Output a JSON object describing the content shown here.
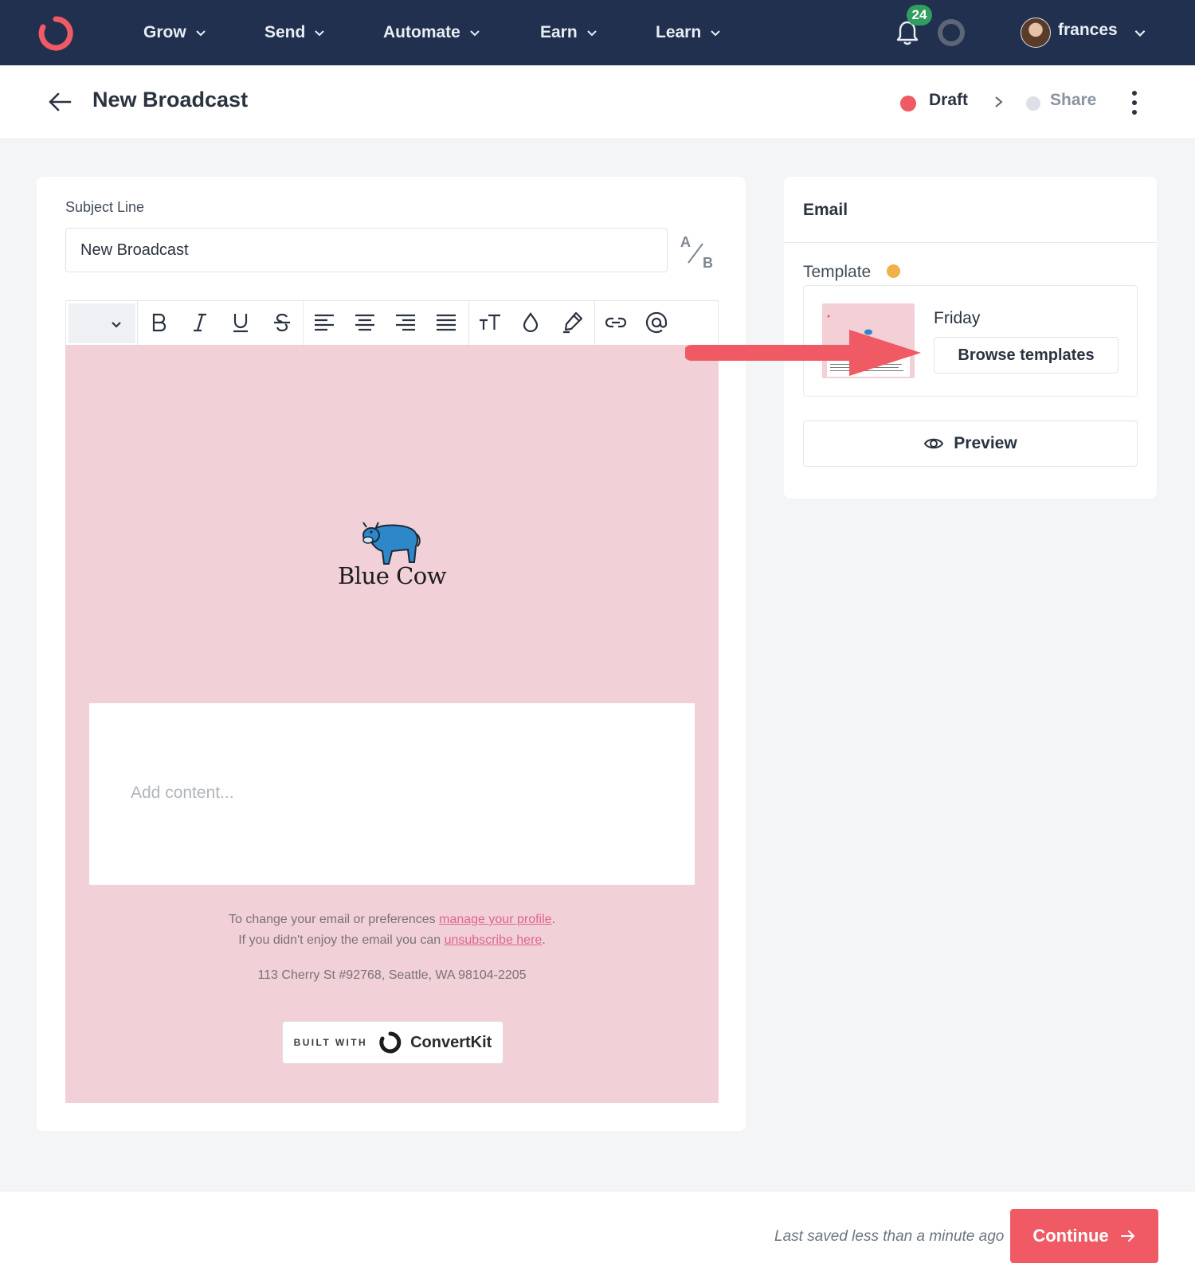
{
  "nav": {
    "items": [
      {
        "label": "Grow"
      },
      {
        "label": "Send"
      },
      {
        "label": "Automate"
      },
      {
        "label": "Earn"
      },
      {
        "label": "Learn"
      }
    ],
    "notification_count": "24",
    "username": "frances"
  },
  "header": {
    "title": "New Broadcast",
    "steps": [
      {
        "label": "Draft",
        "status": "current",
        "color": "#f05a64"
      },
      {
        "label": "Share",
        "status": "upcoming",
        "color": "#dde1e7"
      }
    ]
  },
  "editor": {
    "subject_label": "Subject Line",
    "subject_value": "New Broadcast",
    "ab_test": {
      "a": "A",
      "b": "B"
    },
    "toolbar": [
      "text-style-select",
      "bold",
      "italic",
      "underline",
      "strikethrough",
      "align-left",
      "align-center",
      "align-right",
      "justify",
      "font-size",
      "text-color",
      "highlight",
      "link",
      "mention"
    ],
    "canvas": {
      "background": "#f1d0d7",
      "brand_name": "Blue Cow",
      "content_placeholder": "Add content...",
      "footer": {
        "line1_prefix": "To change your email or preferences ",
        "line1_link": "manage your profile",
        "line1_suffix": ".",
        "line2_prefix": "If you didn't enjoy the email you can ",
        "line2_link": "unsubscribe here",
        "line2_suffix": ".",
        "address": "113 Cherry St #92768, Seattle, WA 98104-2205"
      },
      "built_with": {
        "label": "BUILT WITH",
        "brand": "ConvertKit"
      }
    }
  },
  "sidebar": {
    "title": "Email",
    "template_label": "Template",
    "template_name": "Friday",
    "browse_label": "Browse templates",
    "preview_label": "Preview"
  },
  "footer": {
    "saved_text": "Last saved less than a minute ago",
    "continue_label": "Continue"
  },
  "colors": {
    "nav_bg": "#21304e",
    "accent": "#f05a64",
    "canvas_pink": "#f1d0d7",
    "badge_green": "#2f9e5f",
    "template_dot": "#f0b04a"
  }
}
